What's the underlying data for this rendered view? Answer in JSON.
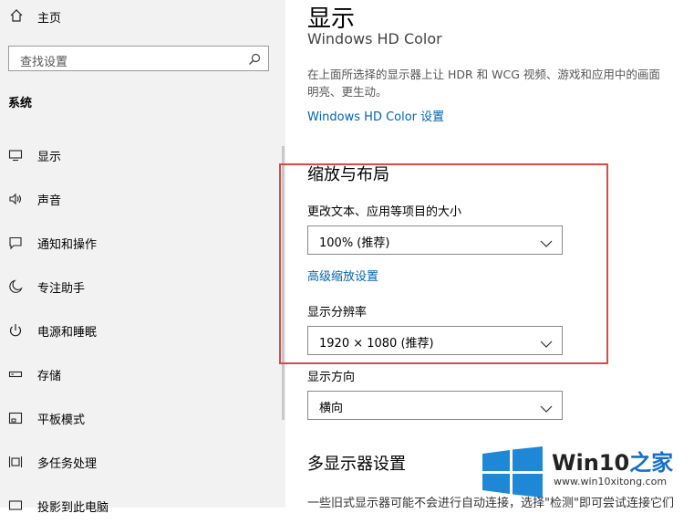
{
  "sidebar": {
    "home_label": "主页",
    "search_placeholder": "查找设置",
    "section_title": "系统",
    "items": [
      {
        "label": "显示",
        "icon": "monitor-icon"
      },
      {
        "label": "声音",
        "icon": "speaker-icon"
      },
      {
        "label": "通知和操作",
        "icon": "notification-icon"
      },
      {
        "label": "专注助手",
        "icon": "moon-icon"
      },
      {
        "label": "电源和睡眠",
        "icon": "power-icon"
      },
      {
        "label": "存储",
        "icon": "storage-icon"
      },
      {
        "label": "平板模式",
        "icon": "tablet-icon"
      },
      {
        "label": "多任务处理",
        "icon": "multitask-icon"
      },
      {
        "label": "投影到此电脑",
        "icon": "project-icon"
      }
    ]
  },
  "main": {
    "title": "显示",
    "clipped_heading": "Windows HD Color",
    "description_line1": "在上面所选择的显示器上让 HDR 和 WCG 视频、游戏和应用中的画面",
    "description_line2": "明亮、更生动。",
    "hd_color_link": "Windows HD Color 设置",
    "scale_heading": "缩放与布局",
    "scale_label": "更改文本、应用等项目的大小",
    "scale_value": "100% (推荐)",
    "advanced_scale_link": "高级缩放设置",
    "resolution_label": "显示分辨率",
    "resolution_value": "1920 × 1080 (推荐)",
    "orientation_label": "显示方向",
    "orientation_value": "横向",
    "multi_display_heading": "多显示器设置",
    "bottom_text": "一些旧式显示器可能不会进行自动连接，选择\"检测\"即可尝试连接它们"
  },
  "watermark": {
    "brand_prefix": "Win10",
    "brand_suffix": "之家",
    "url": "www.win10xitong.com"
  },
  "colors": {
    "link": "#0063b1",
    "highlight_box": "#d94a4a",
    "sidebar_bg": "#f2f2f2"
  }
}
